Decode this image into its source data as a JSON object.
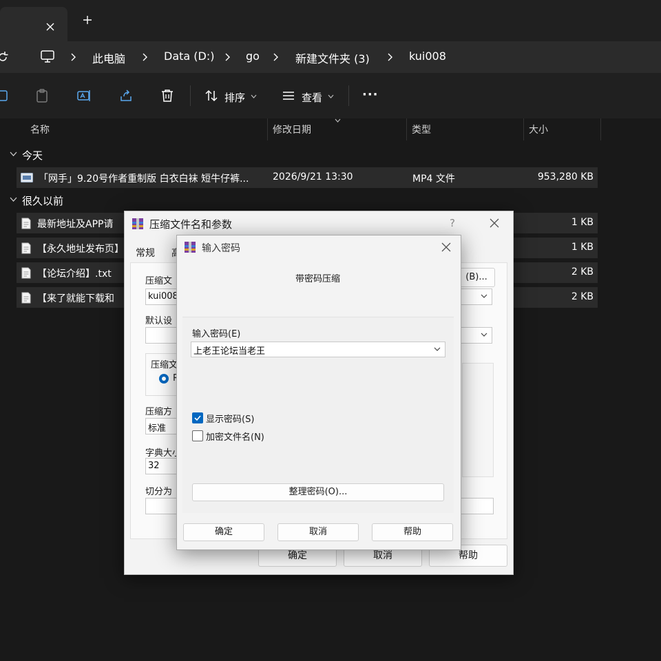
{
  "titlebar": {
    "tab_close": "close-icon",
    "new_tab": "plus-icon"
  },
  "breadcrumb": {
    "items": [
      "此电脑",
      "Data (D:)",
      "go",
      "新建文件夹 (3)",
      "kui008"
    ]
  },
  "commandbar": {
    "sort_label": "排序",
    "view_label": "查看",
    "more_label": "···"
  },
  "columns": {
    "name": "名称",
    "modified": "修改日期",
    "type": "类型",
    "size": "大小"
  },
  "groups": {
    "today": "今天",
    "long_ago": "很久以前"
  },
  "files_today": [
    {
      "name": "「网手」9.20号作者重制版 白衣白袜 短牛仔裤...",
      "modified": "2026/9/21 13:30",
      "type": "MP4 文件",
      "size": "953,280 KB"
    }
  ],
  "files_old": [
    {
      "name": "最新地址及APP请",
      "size": "1 KB"
    },
    {
      "name": "【永久地址发布页】",
      "size": "1 KB"
    },
    {
      "name": "【论坛介绍】.txt",
      "size": "2 KB"
    },
    {
      "name": "【来了就能下载和",
      "size": "2 KB"
    }
  ],
  "archive_dialog": {
    "title": "压缩文件名和参数",
    "help_mark": "?",
    "tab_general": "常规",
    "tab_second": "高",
    "archive_name_label": "压缩文",
    "archive_name_value": "kui008",
    "browse_label": "(B)...",
    "default_profile_label": "默认设",
    "format_group": "压缩文",
    "format_radio_partial": "R",
    "method_label": "压缩方",
    "method_value": "标准",
    "dict_label": "字典大小",
    "dict_value": "32",
    "split_label": "切分为",
    "ok": "确定",
    "cancel": "取消",
    "help": "帮助"
  },
  "password_dialog": {
    "title": "输入密码",
    "heading": "带密码压缩",
    "password_label": "输入密码(E)",
    "password_value": "上老王论坛当老王",
    "show_password_label": "显示密码(S)",
    "show_password_checked": true,
    "encrypt_names_label": "加密文件名(N)",
    "encrypt_names_checked": false,
    "organize_button": "整理密码(O)...",
    "ok": "确定",
    "cancel": "取消",
    "help": "帮助"
  },
  "colors": {
    "accent": "#0067c0",
    "explorer_bg": "#191919",
    "row_selected": "#2b2b2b"
  }
}
